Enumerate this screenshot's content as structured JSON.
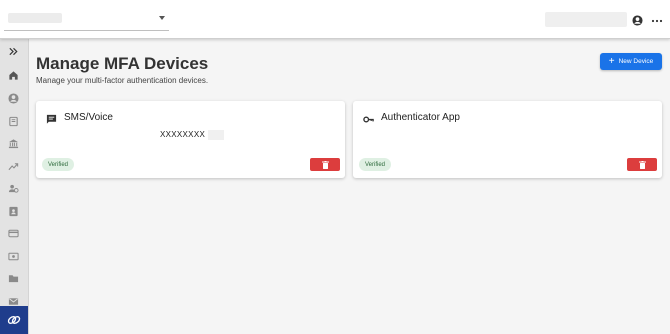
{
  "header": {
    "icons": {
      "account": "account-circle-icon",
      "more": "more-horizontal-icon",
      "org_caret": "chevron-down-icon"
    }
  },
  "sidebar": {
    "items": [
      {
        "name": "expand",
        "icon": "double-chevron-right-icon"
      },
      {
        "name": "home",
        "icon": "home-icon"
      },
      {
        "name": "account",
        "icon": "account-circle-icon"
      },
      {
        "name": "book",
        "icon": "book-icon"
      },
      {
        "name": "bank",
        "icon": "bank-icon"
      },
      {
        "name": "analytics",
        "icon": "trending-icon"
      },
      {
        "name": "users",
        "icon": "users-icon"
      },
      {
        "name": "contacts",
        "icon": "contact-card-icon"
      },
      {
        "name": "card",
        "icon": "credit-card-icon"
      },
      {
        "name": "payments",
        "icon": "cash-icon"
      },
      {
        "name": "folder",
        "icon": "folder-icon"
      },
      {
        "name": "mail",
        "icon": "mail-icon"
      },
      {
        "name": "logo",
        "icon": "link-logo-icon"
      }
    ]
  },
  "page": {
    "title": "Manage MFA Devices",
    "subtitle": "Manage your multi-factor authentication devices.",
    "new_device_label": "New Device"
  },
  "devices": [
    {
      "title": "SMS/Voice",
      "icon": "chat-message-icon",
      "masked_number": "XXXXXXXX",
      "status": "Verified"
    },
    {
      "title": "Authenticator App",
      "icon": "key-icon",
      "masked_number": "",
      "status": "Verified"
    }
  ],
  "colors": {
    "primary": "#1a73e8",
    "danger": "#dc3d3d",
    "verified_bg": "#dff0e3",
    "verified_text": "#2e6b3c",
    "sidebar_bg": "#e3e3e3",
    "logo_bg": "#1f3d8c"
  }
}
